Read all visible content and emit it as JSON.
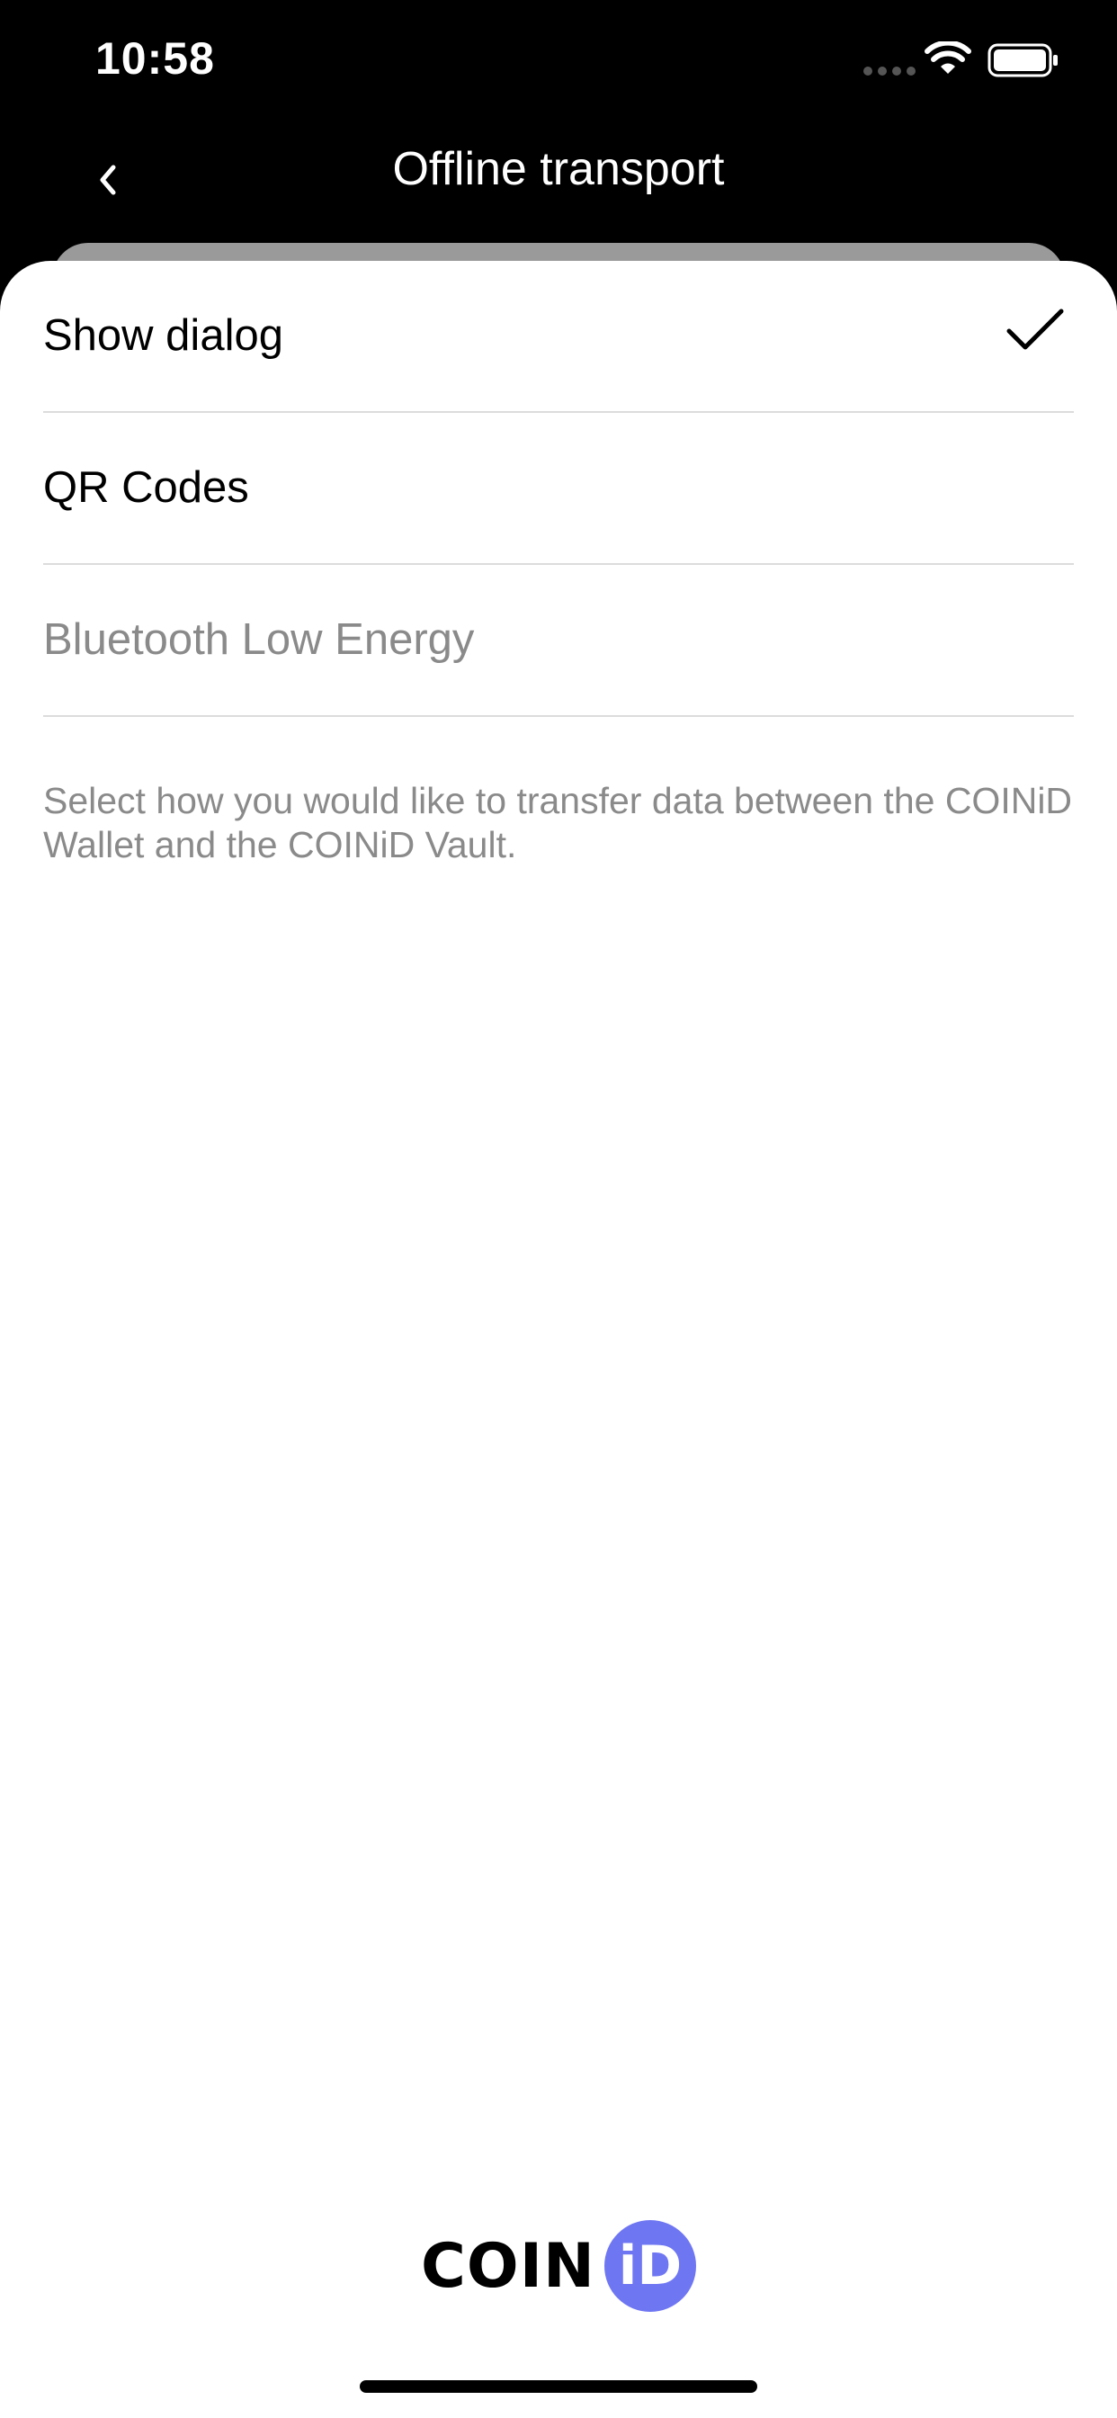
{
  "status_bar": {
    "time": "10:58"
  },
  "nav": {
    "title": "Offline transport"
  },
  "options": [
    {
      "label": "Show dialog",
      "selected": true,
      "disabled": false
    },
    {
      "label": "QR Codes",
      "selected": false,
      "disabled": false
    },
    {
      "label": "Bluetooth Low Energy",
      "selected": false,
      "disabled": true
    }
  ],
  "help_text": "Select how you would like to transfer data between the COINiD Wallet and the COINiD Vault.",
  "brand": {
    "word": "COIN",
    "badge": "iD",
    "badge_color": "#6f76f2"
  },
  "icons": {
    "back": "chevron-left-icon",
    "check": "checkmark-icon",
    "wifi": "wifi-icon",
    "battery": "battery-icon"
  }
}
